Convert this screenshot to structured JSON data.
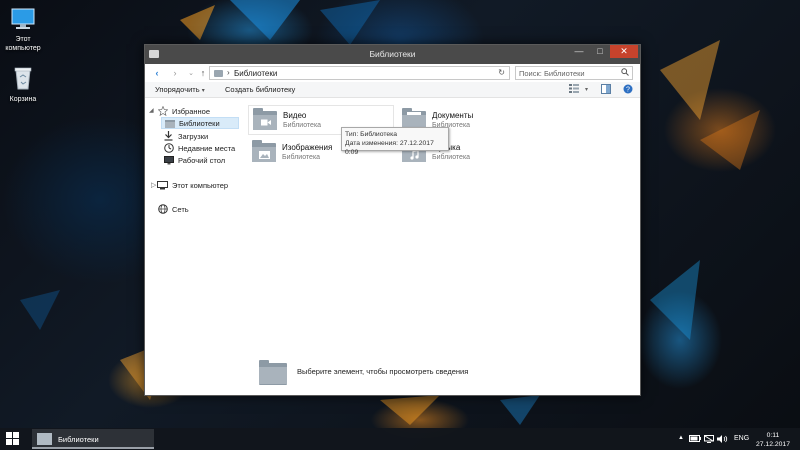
{
  "desktop": {
    "icons": [
      {
        "label": "Этот компьютер",
        "icon": "computer-icon"
      },
      {
        "label": "Корзина",
        "icon": "recycle-bin-icon"
      }
    ]
  },
  "window": {
    "title": "Библиотеки",
    "controls": {
      "minimize": "—",
      "maximize": "□",
      "close": "✕"
    },
    "address": {
      "path": "Библиотеки",
      "separator": "›",
      "refresh": "↻"
    },
    "search": {
      "placeholder": "Поиск: Библиотеки"
    },
    "nav": {
      "back": "‹",
      "forward": "›",
      "up": "↑",
      "recent": "⌄"
    },
    "toolbar": {
      "organize": "Упорядочить",
      "new_library": "Создать библиотеку"
    },
    "sidebar": {
      "favorites": "Избранное",
      "libraries": "Библиотеки",
      "downloads": "Загрузки",
      "recent": "Недавние места",
      "desktop": "Рабочий стол",
      "this_pc": "Этот компьютер",
      "network": "Сеть"
    },
    "libraries": [
      {
        "name": "Видео",
        "type": "Библиотека",
        "icon": "video-folder-icon"
      },
      {
        "name": "Документы",
        "type": "Библиотека",
        "icon": "documents-folder-icon"
      },
      {
        "name": "Изображения",
        "type": "Библиотека",
        "icon": "pictures-folder-icon"
      },
      {
        "name": "Музыка",
        "type": "Библиотека",
        "icon": "music-folder-icon"
      }
    ],
    "tooltip": {
      "type_line": "Тип: Библиотека",
      "date_line": "Дата изменения: 27.12.2017 0:09"
    },
    "details": {
      "hint": "Выберите элемент, чтобы просмотреть сведения"
    }
  },
  "taskbar": {
    "app_label": "Библиотеки",
    "language": "ENG",
    "time": "0:11",
    "date": "27.12.2017"
  }
}
